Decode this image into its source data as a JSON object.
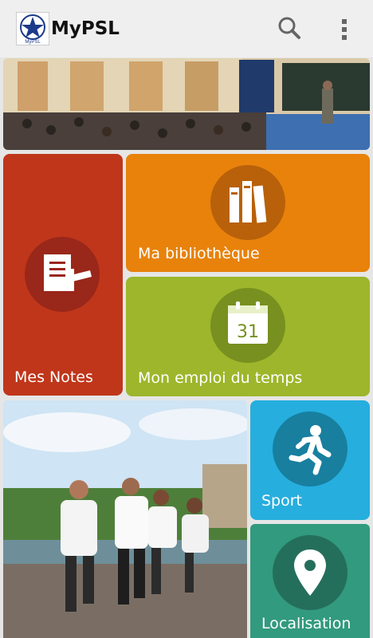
{
  "app": {
    "title": "MyPSL",
    "logo_text": "MyPSL"
  },
  "toolbar": {
    "search_icon": "search-icon",
    "menu_icon": "more-vert-icon"
  },
  "tiles": {
    "notes": {
      "label": "Mes Notes",
      "icon": "note-pencil-icon",
      "color": "#c0361a"
    },
    "library": {
      "label": "Ma bibliothèque",
      "icon": "books-icon",
      "color": "#e8820b"
    },
    "schedule": {
      "label": "Mon emploi du temps",
      "icon": "calendar-icon",
      "calendar_day": "31",
      "color": "#9db62b"
    },
    "sport": {
      "label": "Sport",
      "icon": "running-person-icon",
      "color": "#26aede"
    },
    "location": {
      "label": "Localisation",
      "icon": "map-pin-icon",
      "color": "#329a7e"
    }
  }
}
